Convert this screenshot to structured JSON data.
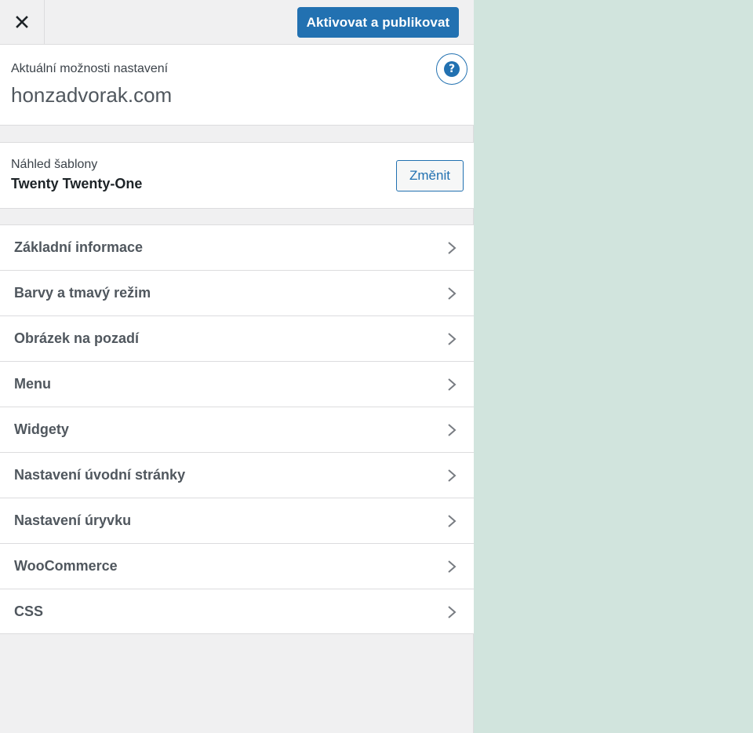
{
  "header": {
    "close_icon": "close-icon",
    "publish_label": "Aktivovat a publikovat"
  },
  "info": {
    "label": "Aktuální možnosti nastavení",
    "site_title": "honzadvorak.com",
    "help_icon": "help-icon"
  },
  "theme": {
    "label": "Náhled šablony",
    "name": "Twenty Twenty-One",
    "change_label": "Změnit"
  },
  "menu": {
    "items": [
      {
        "label": "Základní informace"
      },
      {
        "label": "Barvy a tmavý režim"
      },
      {
        "label": "Obrázek na pozadí"
      },
      {
        "label": "Menu"
      },
      {
        "label": "Widgety"
      },
      {
        "label": "Nastavení úvodní stránky"
      },
      {
        "label": "Nastavení úryvku"
      },
      {
        "label": "WooCommerce"
      },
      {
        "label": "CSS"
      }
    ],
    "chevron_icon": "chevron-right-icon"
  },
  "colors": {
    "accent": "#2271b1",
    "preview_background": "#d1e4dd"
  }
}
